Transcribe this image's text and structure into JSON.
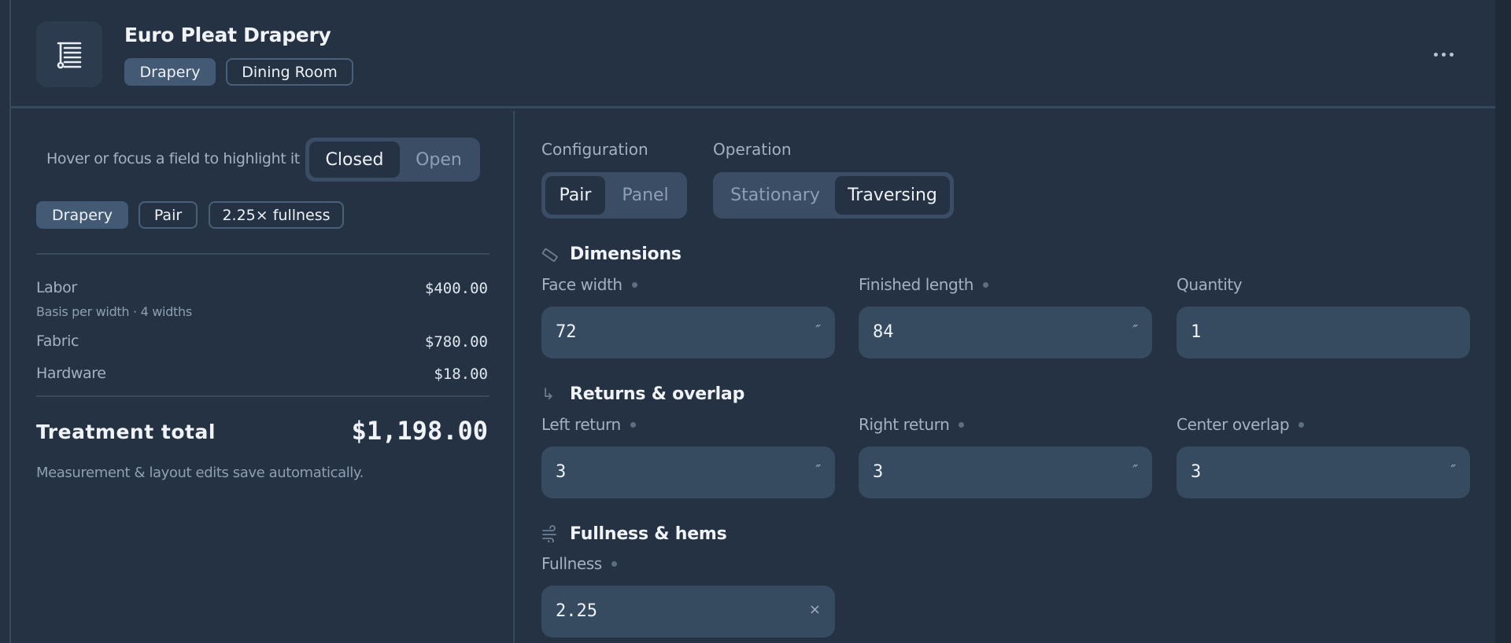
{
  "header": {
    "title": "Euro Pleat Drapery",
    "tags": [
      "Drapery",
      "Dining Room"
    ],
    "logo_icon": "drapery-list-icon",
    "more_icon": "more-horizontal-icon"
  },
  "sidebar": {
    "hint": "Hover or focus a field to highlight it",
    "view_toggle": {
      "options": [
        "Closed",
        "Open"
      ],
      "selected": "Closed"
    },
    "chips": [
      "Drapery",
      "Pair",
      "2.25× fullness"
    ],
    "lines": [
      {
        "label": "Labor",
        "sub": "Basis per width · 4 widths",
        "amount": "$400.00"
      },
      {
        "label": "Fabric",
        "amount": "$780.00"
      },
      {
        "label": "Hardware",
        "amount": "$18.00"
      }
    ],
    "total_label": "Treatment total",
    "total_amount": "$1,198.00",
    "footnote": "Measurement & layout edits save automatically."
  },
  "main": {
    "configuration": {
      "label": "Configuration",
      "options": [
        "Pair",
        "Panel"
      ],
      "selected": "Pair"
    },
    "operation": {
      "label": "Operation",
      "options": [
        "Stationary",
        "Traversing"
      ],
      "selected": "Traversing"
    },
    "dimensions": {
      "title": "Dimensions",
      "icon": "ruler-icon",
      "fields": [
        {
          "label": "Face width",
          "value": "72",
          "unit": "″"
        },
        {
          "label": "Finished length",
          "value": "84",
          "unit": "″"
        },
        {
          "label": "Quantity",
          "value": "1",
          "unit": ""
        }
      ]
    },
    "returns": {
      "title": "Returns & overlap",
      "icon": "return-arrow-icon",
      "fields": [
        {
          "label": "Left return",
          "value": "3",
          "unit": "″"
        },
        {
          "label": "Right return",
          "value": "3",
          "unit": "″"
        },
        {
          "label": "Center overlap",
          "value": "3",
          "unit": "″"
        }
      ]
    },
    "fullness": {
      "title": "Fullness & hems",
      "icon": "wind-icon",
      "fields": [
        {
          "label": "Fullness",
          "value": "2.25",
          "unit": "×"
        }
      ]
    }
  },
  "colors": {
    "background": "#253244",
    "field": "#364a60",
    "chip_filled": "#435a74",
    "segment": "#3a4d64"
  }
}
